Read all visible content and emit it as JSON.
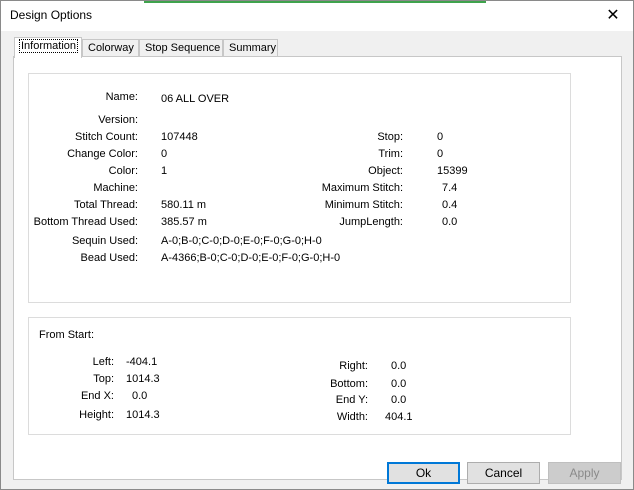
{
  "window": {
    "title": "Design Options",
    "close_glyph": "✕"
  },
  "tabs": [
    {
      "label": "Information",
      "active": true
    },
    {
      "label": "Colorway",
      "active": false
    },
    {
      "label": "Stop Sequence",
      "active": false
    },
    {
      "label": "Summary",
      "active": false
    }
  ],
  "info": {
    "name_label": "Name:",
    "name_value": "06 ALL OVER",
    "version_label": "Version:",
    "version_value": "",
    "stitch_count_label": "Stitch Count:",
    "stitch_count_value": "107448",
    "change_color_label": "Change Color:",
    "change_color_value": "0",
    "color_label": "Color:",
    "color_value": "1",
    "machine_label": "Machine:",
    "machine_value": "",
    "total_thread_label": "Total Thread:",
    "total_thread_value": "580.11 m",
    "bottom_thread_label": "Bottom Thread Used:",
    "bottom_thread_value": "385.57 m",
    "sequin_label": "Sequin Used:",
    "sequin_value": "A-0;B-0;C-0;D-0;E-0;F-0;G-0;H-0",
    "bead_label": "Bead Used:",
    "bead_value": "A-4366;B-0;C-0;D-0;E-0;F-0;G-0;H-0",
    "stop_label": "Stop:",
    "stop_value": "0",
    "trim_label": "Trim:",
    "trim_value": "0",
    "object_label": "Object:",
    "object_value": "15399",
    "max_stitch_label": "Maximum Stitch:",
    "max_stitch_value": "7.4",
    "min_stitch_label": "Minimum Stitch:",
    "min_stitch_value": "0.4",
    "jump_length_label": "JumpLength:",
    "jump_length_value": "0.0"
  },
  "from_start": {
    "heading": "From Start:",
    "left_label": "Left:",
    "left_value": "-404.1",
    "top_label": "Top:",
    "top_value": "1014.3",
    "endx_label": "End X:",
    "endx_value": "0.0",
    "height_label": "Height:",
    "height_value": "1014.3",
    "right_label": "Right:",
    "right_value": "0.0",
    "bottom_label": "Bottom:",
    "bottom_value": "0.0",
    "endy_label": "End Y:",
    "endy_value": "0.0",
    "width_label": "Width:",
    "width_value": "404.1"
  },
  "buttons": {
    "ok": "Ok",
    "cancel": "Cancel",
    "apply": "Apply"
  },
  "colors": {
    "title_accent": "#3fa34d",
    "default_button_border": "#0078d7"
  }
}
